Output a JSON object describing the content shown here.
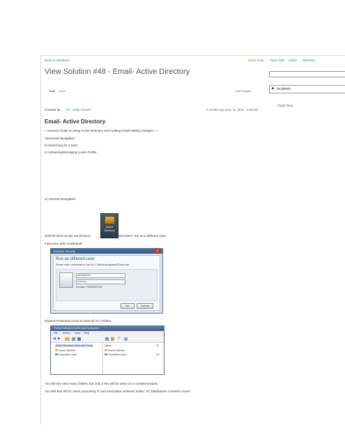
{
  "header": {
    "back_link": "Back to Solutions",
    "show_help": "Show Help",
    "nav_view": "New View",
    "nav_active": "active",
    "nav_directory": "Directory",
    "title": "View Solution #48 - Email- Active Directory",
    "incidents_label": "Incidents"
  },
  "toolbar": {
    "state_label": "State",
    "state_value": "Email",
    "edit_solution": "Edit Solution",
    "track_time": "Track Time"
  },
  "meta": {
    "created_by_label": "Created by:",
    "initials": "AP",
    "author": "Andy Penner",
    "timestamp": "8 months ago (Nov 16, 2015 - 9:06AM)"
  },
  "article": {
    "heading": "Email- Active Directory",
    "intro": "I. General Guide to using Active Directory and making Email setting changes-----",
    "item_a": "a)General Navigation",
    "item_b": "b) Searching for a User",
    "item_c": "c) Activating/Managing a user Profile",
    "section_a": "a) General Navigation",
    "shortcut_before": "Shift+R-Click on the AD shortcut",
    "shortcut_after": "and select \"run as a different user\"",
    "ad_icon_label": "Active Directory",
    "admin_creds": "Input your adm credentials",
    "expand_text": "Expand Federation.local to view all VC Folders",
    "many_folders": "You will see very many folders, but only a few will be used on a consistent basis",
    "find_users": "You Will find all DC users (excluding IT and most labor workers) under: VC Distribution Centers> Users"
  },
  "security_dialog": {
    "window_title": "Windows Security",
    "heading": "Run as different user",
    "prompt": "Please enter credentials to use for C:\\Windows\\system32\\dsa.msc",
    "username": "admrpenner",
    "password": "••••••••••",
    "domain": "Domain: FEDERATION",
    "ok": "OK",
    "cancel": "Cancel"
  },
  "ad_window": {
    "title": "Active Directory Users and Computers",
    "menu": [
      "File",
      "Action",
      "View",
      "Help"
    ],
    "tree_root": "Active Directory Users and Comp",
    "tree_items": [
      "Saved Queries",
      "Federation.local"
    ],
    "col_name": "Name",
    "col_type": "Ty",
    "list_items": [
      "Saved Queries",
      "Federation.local"
    ],
    "list_type_2": "Do"
  }
}
